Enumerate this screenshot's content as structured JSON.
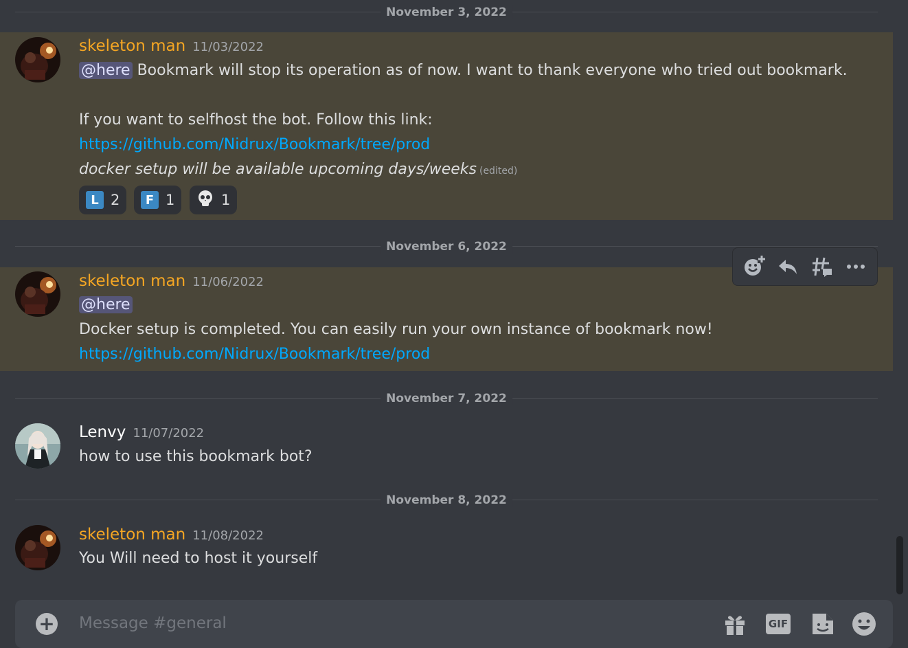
{
  "dates": [
    "November 3, 2022",
    "November 6, 2022",
    "November 7, 2022",
    "November 8, 2022"
  ],
  "messages": [
    {
      "username": "skeleton man",
      "timestamp": "11/03/2022",
      "mention": "@here",
      "line1": " Bookmark will stop its operation as of now. I want to thank everyone who tried out bookmark.",
      "line2": "If you want to selfhost the bot. Follow this link:",
      "link": "https://github.com/Nidrux/Bookmark/tree/prod",
      "line4": " docker setup will be available upcoming days/weeks",
      "edited": "(edited)",
      "reactions": [
        {
          "emoji": "L",
          "count": "2"
        },
        {
          "emoji": "F",
          "count": "1"
        },
        {
          "emoji": "skull-emoji",
          "count": "1"
        }
      ]
    },
    {
      "username": "skeleton man",
      "timestamp": "11/06/2022",
      "mention": "@here",
      "line2": "Docker setup is completed. You can easily run your own instance of bookmark now!",
      "link": "https://github.com/Nidrux/Bookmark/tree/prod"
    },
    {
      "username": "Lenvy",
      "timestamp": "11/07/2022",
      "line1": "how to use this bookmark bot?"
    },
    {
      "username": "skeleton man",
      "timestamp": "11/08/2022",
      "line1": "You Will need to host it yourself"
    }
  ],
  "toolbar": [
    "add-reaction-icon",
    "reply-icon",
    "create-thread-icon",
    "more-icon"
  ],
  "composer": {
    "placeholder": "Message #general",
    "gif_label": "GIF",
    "icons": [
      "plus-icon",
      "gift-icon",
      "gif-icon",
      "sticker-icon",
      "emoji-icon"
    ]
  },
  "colors": {
    "background": "#36393f",
    "highlight": "#4a4639",
    "username_accent": "#f5a623",
    "link": "#00a8fc",
    "mention_bg": "#565678"
  }
}
